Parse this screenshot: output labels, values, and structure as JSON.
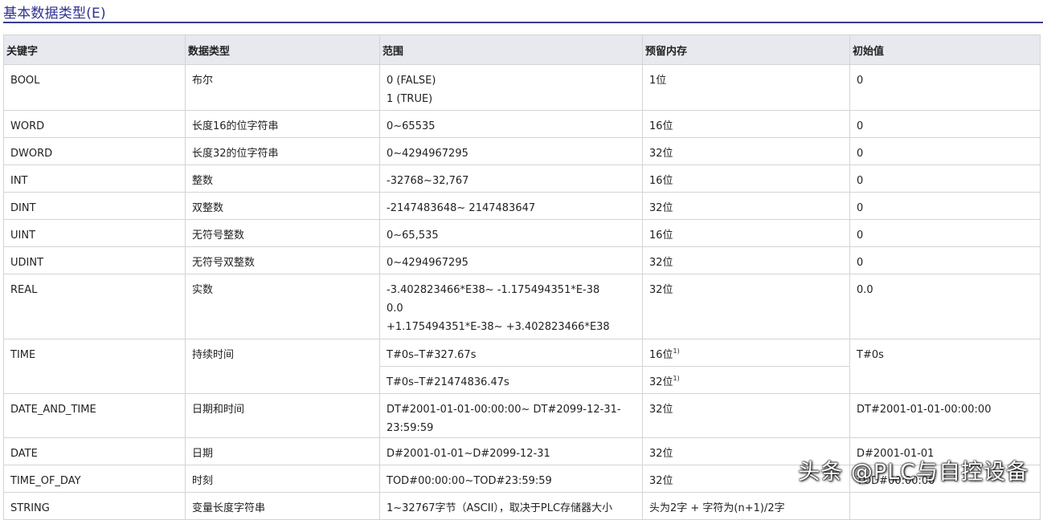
{
  "section_title": "基本数据类型(E)",
  "columns": [
    "关键字",
    "数据类型",
    "范围",
    "预留内存",
    "初始值"
  ],
  "rows": [
    {
      "keyword": "BOOL",
      "type": "布尔",
      "range": [
        "0 (FALSE)",
        "1 (TRUE)"
      ],
      "memory": "1位",
      "initial": "0"
    },
    {
      "keyword": "WORD",
      "type": "长度16的位字符串",
      "range": [
        "0~65535"
      ],
      "memory": "16位",
      "initial": "0"
    },
    {
      "keyword": "DWORD",
      "type": "长度32的位字符串",
      "range": [
        "0~4294967295"
      ],
      "memory": "32位",
      "initial": "0"
    },
    {
      "keyword": "INT",
      "type": "整数",
      "range": [
        "-32768~32,767"
      ],
      "memory": "16位",
      "initial": "0"
    },
    {
      "keyword": "DINT",
      "type": "双整数",
      "range": [
        "-2147483648~ 2147483647"
      ],
      "memory": "32位",
      "initial": "0"
    },
    {
      "keyword": "UINT",
      "type": "无符号整数",
      "range": [
        "0~65,535"
      ],
      "memory": "16位",
      "initial": "0"
    },
    {
      "keyword": "UDINT",
      "type": "无符号双整数",
      "range": [
        "0~4294967295"
      ],
      "memory": "32位",
      "initial": "0"
    },
    {
      "keyword": "REAL",
      "type": "实数",
      "range": [
        "-3.402823466*E38~ -1.175494351*E-38",
        "0.0",
        "+1.175494351*E-38~ +3.402823466*E38"
      ],
      "memory": "32位",
      "initial": "0.0"
    },
    {
      "keyword": "TIME",
      "type": "持续时间",
      "subrows": [
        {
          "range": "T#0s–T#327.67s",
          "memory": "16位",
          "footnote": "1)"
        },
        {
          "range": "T#0s–T#21474836.47s",
          "memory": "32位",
          "footnote": "1)"
        }
      ],
      "initial": "T#0s"
    },
    {
      "keyword": "DATE_AND_TIME",
      "type": "日期和时间",
      "range": [
        "DT#2001-01-01-00:00:00~ DT#2099-12-31-23:59:59"
      ],
      "memory": "32位",
      "initial": "DT#2001-01-01-00:00:00"
    },
    {
      "keyword": "DATE",
      "type": "日期",
      "range": [
        "D#2001-01-01~D#2099-12-31"
      ],
      "memory": "32位",
      "initial": "D#2001-01-01"
    },
    {
      "keyword": "TIME_OF_DAY",
      "type": "时刻",
      "range": [
        "TOD#00:00:00~TOD#23:59:59"
      ],
      "memory": "32位",
      "initial": "TOD#00:00:00"
    },
    {
      "keyword": "STRING",
      "type": "变量长度字符串",
      "range": [
        "1~32767字节（ASCII），取决于PLC存储器大小"
      ],
      "memory": "头为2字 + 字符为(n+1)/2字",
      "initial": ""
    }
  ],
  "watermark": "头条 @PLC与自控设备"
}
